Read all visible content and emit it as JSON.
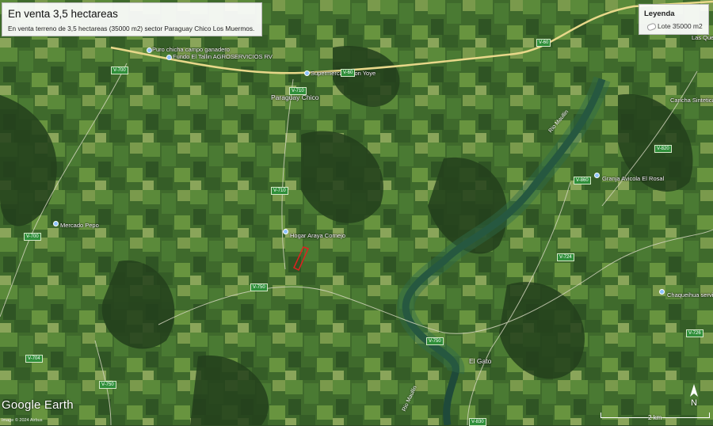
{
  "title_box": {
    "title": "En venta 3,5 hectareas",
    "subtitle": "En venta terreno de 3,5 hectareas (35000 m2) sector Paraguay Chico Los Muermos."
  },
  "legend": {
    "title": "Leyenda",
    "item": "Lote 35000 m2"
  },
  "places": {
    "p1": "Puro chicha campo ganadero",
    "p2": "Fundo El Tallin AGROSERVICIOS RV",
    "p3": "Supermercado Lon Yoye",
    "p4": "Paraguay Chico",
    "p5": "Mercado Pepo",
    "p6": "Hogar Araya Cornejo",
    "p7": "Granja Avicola El Rosal",
    "p8": "Cancha Sintetica",
    "p9": "Las Quemas",
    "p10": "Chaqueihua servicentro",
    "p11": "El Gato",
    "river1": "Rio Maullin",
    "river2": "Rio Maullin"
  },
  "roads": {
    "r1": "V-700",
    "r2": "V-710",
    "r3": "V-60",
    "r4": "V-60",
    "r5": "V-710",
    "r6": "V-700",
    "r7": "V-750",
    "r8": "V-750",
    "r9": "V-704",
    "r10": "V-750",
    "r11": "V-860",
    "r12": "V-820",
    "r13": "V-724",
    "r14": "V-726",
    "r15": "V-830"
  },
  "branding": {
    "name": "Google Earth",
    "credit": "Image © 2024 Airbus",
    "scale": "2 km",
    "north": "N"
  },
  "colors": {
    "plot_outline": "#e02020",
    "highway": "#e8d88a",
    "water": "#1f4a3a",
    "shield": "#2f8f3a"
  }
}
